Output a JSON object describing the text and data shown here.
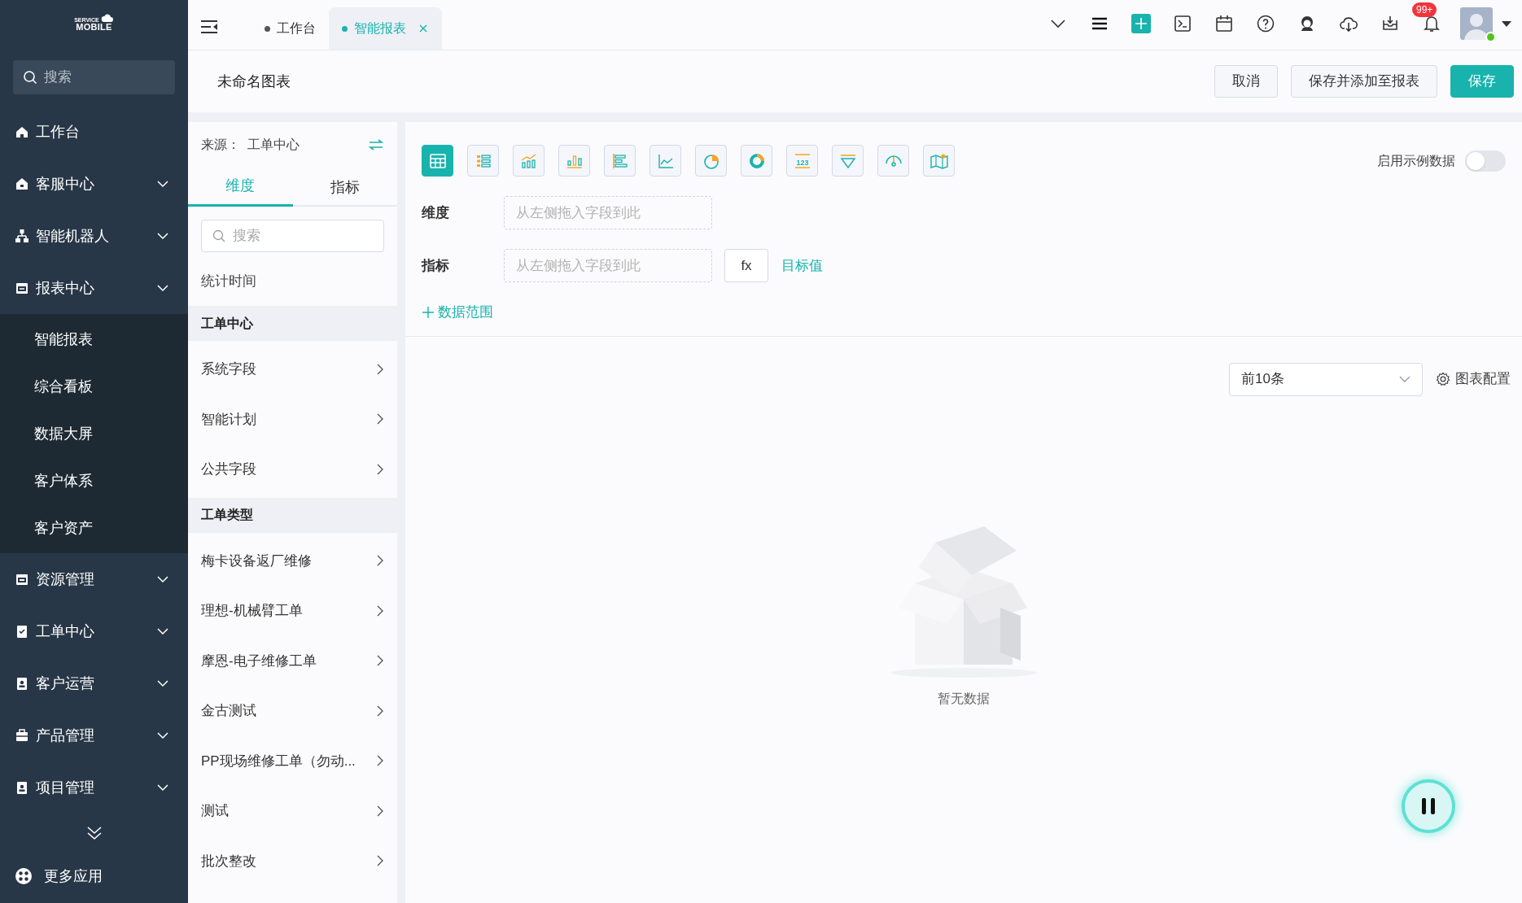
{
  "sidebar": {
    "logo": {
      "line_1": "SERVICE",
      "line_2": "MOBILE"
    },
    "search": {
      "placeholder": "搜索"
    },
    "items": [
      {
        "label": "工作台",
        "kind": "link"
      },
      {
        "label": "客服中心",
        "kind": "group",
        "expanded": false
      },
      {
        "label": "智能机器人",
        "kind": "group",
        "expanded": false
      },
      {
        "label": "报表中心",
        "kind": "group",
        "expanded": true,
        "children": [
          {
            "label": "智能报表"
          },
          {
            "label": "综合看板"
          },
          {
            "label": "数据大屏"
          },
          {
            "label": "客户体系"
          },
          {
            "label": "客户资产"
          }
        ]
      },
      {
        "label": "资源管理",
        "kind": "group",
        "expanded": false
      },
      {
        "label": "工单中心",
        "kind": "group",
        "expanded": false
      },
      {
        "label": "客户运营",
        "kind": "group",
        "expanded": false
      },
      {
        "label": "产品管理",
        "kind": "group",
        "expanded": false
      },
      {
        "label": "项目管理",
        "kind": "group",
        "expanded": false
      }
    ],
    "more": "更多应用"
  },
  "tabs": [
    {
      "label": "工作台",
      "selected": false,
      "closable": false
    },
    {
      "label": "智能报表",
      "selected": true,
      "closable": true
    }
  ],
  "header": {
    "notification_badge": "99+"
  },
  "title": "未命名图表",
  "actions": [
    {
      "label": "取消",
      "kind": "default"
    },
    {
      "label": "保存并添加至报表",
      "kind": "default"
    },
    {
      "label": "保存",
      "kind": "primary"
    }
  ],
  "field_panel": {
    "source": "来源：  工单中心",
    "tabs": [
      {
        "label": "维度",
        "selected": true
      },
      {
        "label": "指标",
        "selected": false
      }
    ],
    "search": {
      "placeholder": "搜索"
    },
    "items": [
      {
        "label": "统计时间",
        "kind": "field"
      },
      {
        "label": "工单中心",
        "kind": "header"
      },
      {
        "label": "系统字段",
        "kind": "folder"
      },
      {
        "label": "智能计划",
        "kind": "folder"
      },
      {
        "label": "公共字段",
        "kind": "folder"
      },
      {
        "label": "工单类型",
        "kind": "header"
      },
      {
        "label": "梅卡设备返厂维修",
        "kind": "folder"
      },
      {
        "label": "理想-机械臂工单",
        "kind": "folder"
      },
      {
        "label": "摩恩-电子维修工单",
        "kind": "folder"
      },
      {
        "label": "金古测试",
        "kind": "folder"
      },
      {
        "label": "PP现场维修工单（勿动...",
        "kind": "folder"
      },
      {
        "label": "测试",
        "kind": "folder"
      },
      {
        "label": "批次整改",
        "kind": "folder"
      }
    ]
  },
  "chart_types": [
    {
      "kind": "table",
      "selected": true
    },
    {
      "kind": "list",
      "selected": false
    },
    {
      "kind": "combo",
      "selected": false
    },
    {
      "kind": "column",
      "selected": false
    },
    {
      "kind": "bar",
      "selected": false
    },
    {
      "kind": "line",
      "selected": false
    },
    {
      "kind": "pie",
      "selected": false
    },
    {
      "kind": "donut",
      "selected": false
    },
    {
      "kind": "number",
      "selected": false,
      "text": "123"
    },
    {
      "kind": "funnel",
      "selected": false
    },
    {
      "kind": "gauge",
      "selected": false
    },
    {
      "kind": "map",
      "selected": false
    }
  ],
  "sample_data": {
    "label": "启用示例数据",
    "on": false
  },
  "config": {
    "dimension": {
      "label": "维度",
      "placeholder": "从左侧拖入字段到此"
    },
    "metric": {
      "label": "指标",
      "placeholder": "从左侧拖入字段到此",
      "formula": "fx",
      "target": "目标值"
    },
    "data_range": "数据范围"
  },
  "preview": {
    "limit": "前10条",
    "settings": "图表配置",
    "empty": "暂无数据"
  }
}
